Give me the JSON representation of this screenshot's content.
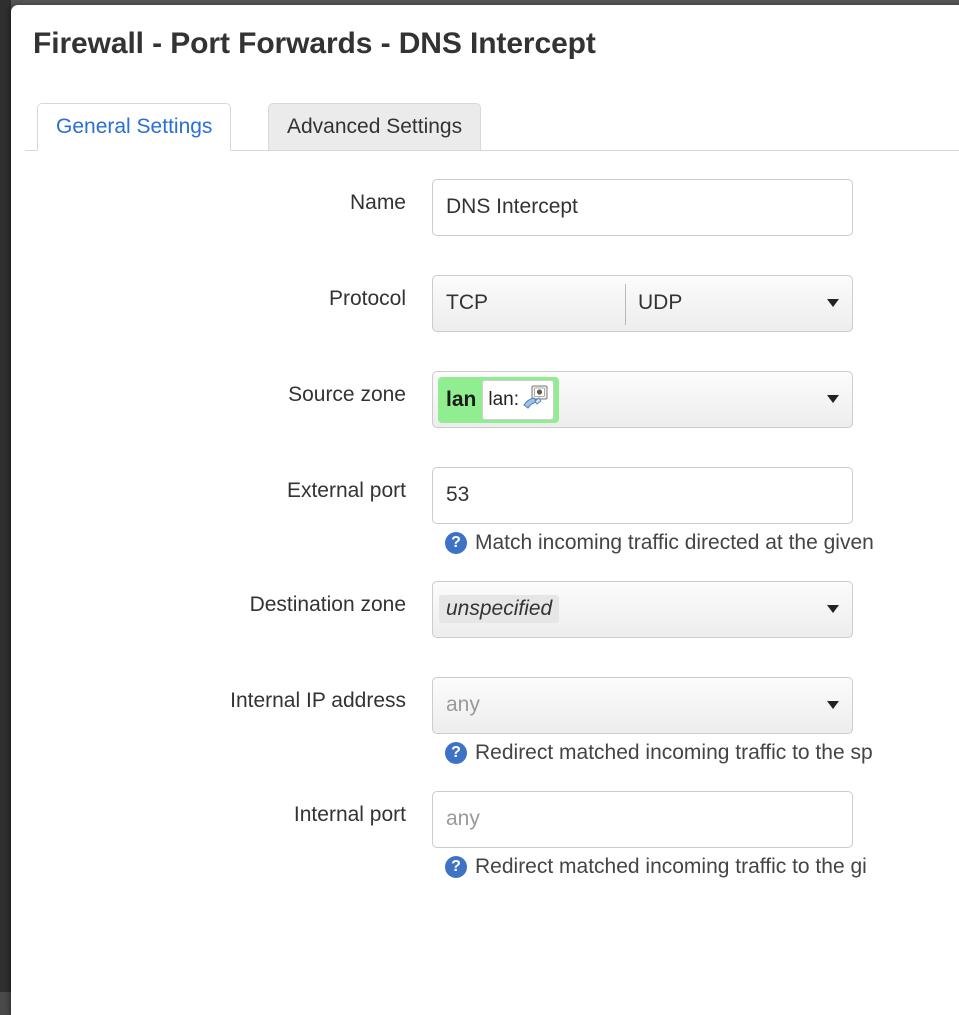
{
  "window": {
    "title": "Firewall - Port Forwards - DNS Intercept"
  },
  "tabs": [
    {
      "label": "General Settings",
      "active": true
    },
    {
      "label": "Advanced Settings",
      "active": false
    }
  ],
  "form": {
    "rows": [
      {
        "label": "Name",
        "kind": "text",
        "value": "DNS Intercept"
      },
      {
        "label": "Protocol",
        "kind": "multiselect",
        "token_a": "TCP",
        "token_b": "UDP"
      },
      {
        "label": "Source zone",
        "kind": "zone",
        "zone_name": "lan",
        "zone_iface_label": "lan:",
        "zone_iface_icon": "ethernet-device-icon"
      },
      {
        "label": "External port",
        "kind": "text",
        "value": "53",
        "help": "Match incoming traffic directed at the given"
      },
      {
        "label": "Destination zone",
        "kind": "select",
        "value": "unspecified",
        "emphasis": "italic-highlight"
      },
      {
        "label": "Internal IP address",
        "kind": "select",
        "value": "any",
        "placeholder": true,
        "help": "Redirect matched incoming traffic to the sp"
      },
      {
        "label": "Internal port",
        "kind": "text",
        "value": "",
        "placeholder_text": "any",
        "help": "Redirect matched incoming traffic to the gi"
      }
    ]
  },
  "colors": {
    "tab_active_text": "#2a6fd4",
    "zone_badge": "#90ee90",
    "help_icon": "#3e72c4",
    "panel_bg": "#ffffff",
    "backdrop": "#545454"
  },
  "icons": {
    "help": "?",
    "caret": "dropdown-caret-icon"
  }
}
